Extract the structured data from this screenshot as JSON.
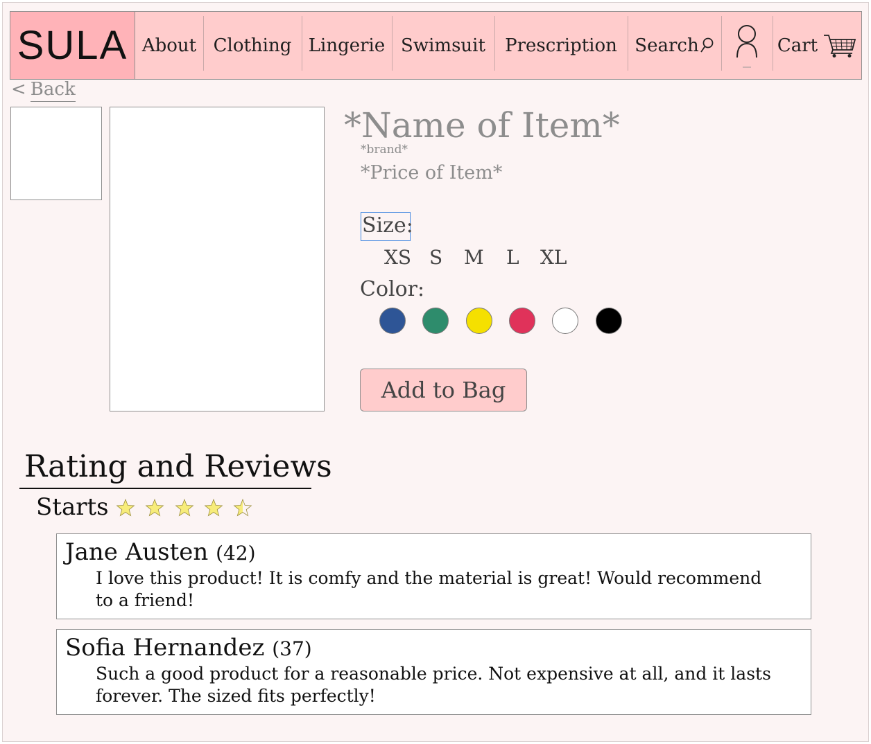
{
  "brand": {
    "logo": "SULA"
  },
  "nav": {
    "items": [
      {
        "label": "About"
      },
      {
        "label": "Clothing"
      },
      {
        "label": "Lingerie"
      },
      {
        "label": "Swimsuit"
      },
      {
        "label": "Prescription"
      },
      {
        "label": "Search"
      }
    ],
    "cart_label": "Cart"
  },
  "back": {
    "arrow": "<",
    "label": "Back"
  },
  "product": {
    "name": "*Name of Item*",
    "brand": "*brand*",
    "price": "*Price of Item*",
    "size_label": "Size:",
    "sizes": [
      "XS",
      "S",
      "M",
      "L",
      "XL"
    ],
    "color_label": "Color:",
    "colors": [
      "#2e5596",
      "#2e8c6c",
      "#f5e000",
      "#e0325a",
      "#ffffff",
      "#000000"
    ],
    "add_button": "Add to Bag"
  },
  "reviews": {
    "title": "Rating and Reviews",
    "stars_label": "Starts",
    "rating": 4.5,
    "items": [
      {
        "name": "Jane Austen",
        "count": "(42)",
        "text": "I love this product! It is comfy and the material is great! Would recommend to a friend!"
      },
      {
        "name": "Sofia Hernandez",
        "count": "(37)",
        "text": "Such a good product for a reasonable price. Not expensive at all, and it lasts forever. The sized fits perfectly!"
      }
    ]
  },
  "colors": {
    "nav_bg": "#ffcccc",
    "logo_bg": "#ffb3b8",
    "page_bg": "#fcf4f4",
    "star": "#f7ec7a"
  }
}
